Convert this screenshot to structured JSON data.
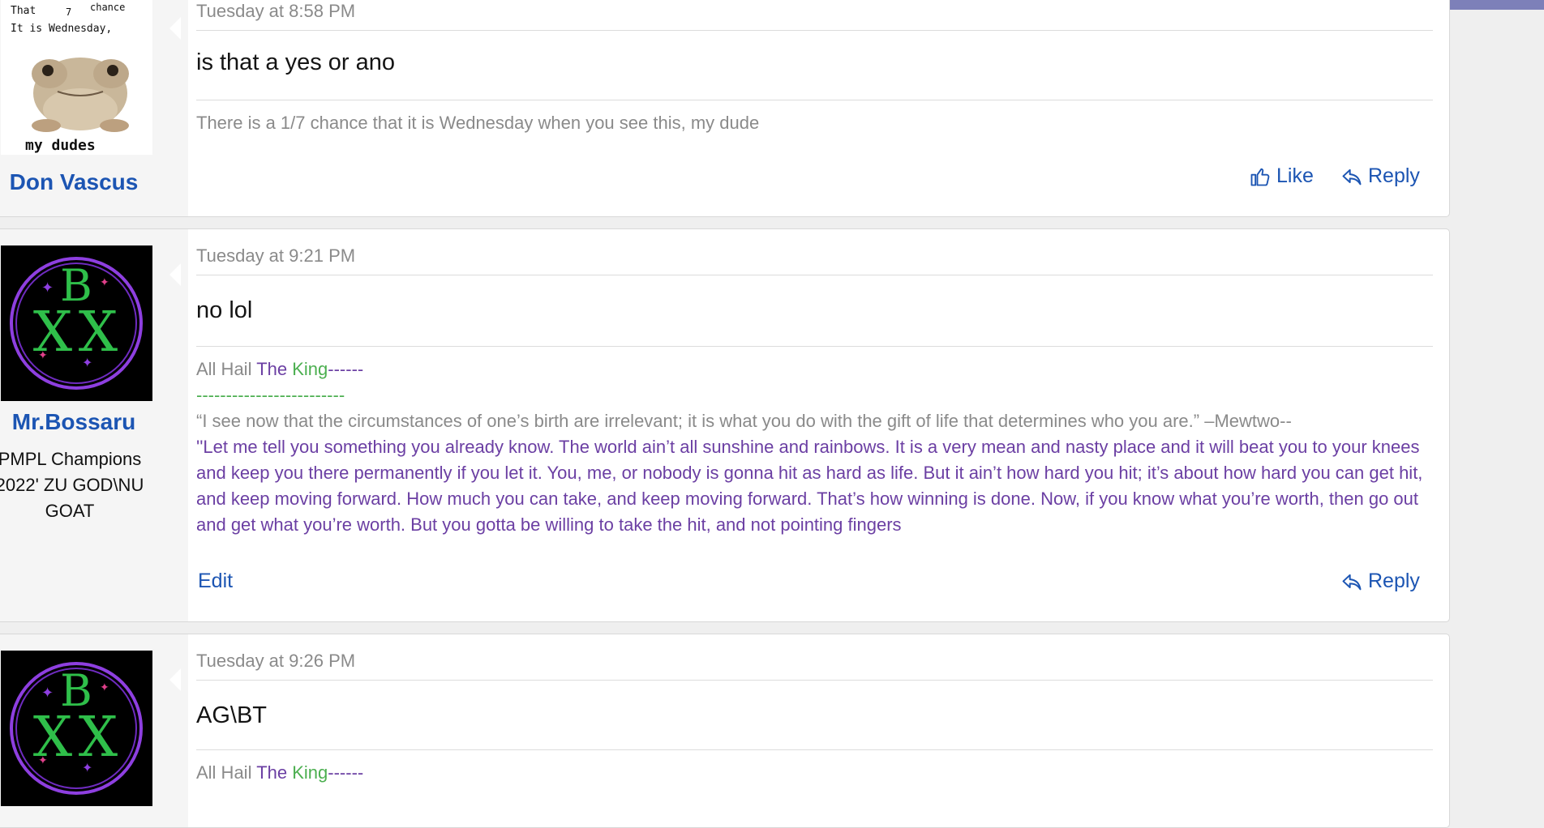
{
  "colors": {
    "accent": "#1c55b3",
    "purple": "#6b3fa3",
    "green": "#4caf50",
    "topbar": "#6b6fae"
  },
  "posts": [
    {
      "frog_text_top_left": "That",
      "frog_text_top_right": "chance",
      "frog_fraction": "7",
      "frog_text_line": "It is Wednesday,",
      "frog_text_bottom": "my dudes",
      "username": "Don Vascus",
      "date": "Tuesday at 8:58 PM",
      "message": "is that a yes or ano",
      "signature": "There is a 1/7 chance that it is Wednesday when you see this, my dude",
      "like_label": "Like",
      "reply_label": "Reply"
    },
    {
      "avatar_letters": {
        "top": "B",
        "left": "X",
        "right": "X"
      },
      "username": "Mr.Bossaru",
      "user_title_lines": [
        "PMPL Champions",
        "2022' ZU GOD\\NU",
        "GOAT"
      ],
      "date": "Tuesday at 9:21 PM",
      "message": "no lol",
      "sig_part1": "All Hail ",
      "sig_part2": "The ",
      "sig_part3": "King",
      "sig_part4": "------",
      "sig_dashes": "-------------------------",
      "sig_quote1": "“I see now that the circumstances of one’s birth are irrelevant; it is what you do with the gift of life that determines who you are.” –Mewtwo--",
      "sig_quote2": "''Let me tell you something you already know. The world ain’t all sunshine and rainbows. It is a very mean and nasty place and it will beat you to your knees and keep you there permanently if you let it. You, me, or nobody is gonna hit as hard as life. But it ain’t how hard you hit; it’s about how hard you can get hit, and keep moving forward. How much you can take, and keep moving forward. That’s how winning is done. Now, if you know what you’re worth, then go out and get what you’re worth. But you gotta be willing to take the hit, and not pointing fingers",
      "edit_label": "Edit",
      "reply_label": "Reply"
    },
    {
      "avatar_letters": {
        "top": "B",
        "left": "X",
        "right": "X"
      },
      "date": "Tuesday at 9:26 PM",
      "message": "AG\\BT",
      "sig_part1": "All Hail ",
      "sig_part2": "The ",
      "sig_part3": "King",
      "sig_part4": "------"
    }
  ]
}
